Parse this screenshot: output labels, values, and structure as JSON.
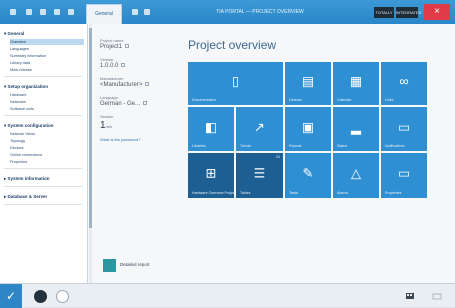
{
  "titlebar": {
    "active_tab": "General",
    "window_title": "TIA PORTAL — PROJECT OVERVIEW",
    "btn_left": "TOTALLY",
    "btn_right": "INTEGRATED",
    "close_glyph": "×"
  },
  "sidebar": {
    "sections": [
      {
        "title": "▾ General",
        "items": [
          "Overview",
          "Languages",
          "Summary information",
          "Library data",
          "Multi-release"
        ]
      },
      {
        "title": "▾ Setup organization",
        "items": [
          "Hardware",
          "Networks",
          "Software units"
        ]
      },
      {
        "title": "▾ System configuration",
        "items": [
          "Network Views",
          "Topology",
          "Devices",
          "Online connections",
          "Properties"
        ]
      },
      {
        "title": "▸ System information",
        "items": []
      },
      {
        "title": "▸ Database & Server",
        "items": []
      }
    ],
    "active_item": "Overview"
  },
  "properties": {
    "fields": [
      {
        "label": "Project name",
        "value": "Project1"
      },
      {
        "label": "Version",
        "value": "1.0.0.0"
      },
      {
        "label": "Manufacturer",
        "value": "<Manufacturer>"
      },
      {
        "label": "Language",
        "value": "German - Ge..."
      },
      {
        "label": "Version",
        "value": "1",
        "unit": "min"
      }
    ],
    "link": "What is the password?",
    "nav_tile_label": "Detailed report"
  },
  "overview": {
    "title": "Project overview",
    "tiles": [
      {
        "label": "Documentation",
        "icon": "document-icon",
        "glyph": "▯",
        "count": "",
        "dark": false
      },
      {
        "label": "Devices",
        "icon": "devices-icon",
        "glyph": "▤",
        "count": "",
        "dark": false
      },
      {
        "label": "Calendar",
        "icon": "calendar-icon",
        "glyph": "▦",
        "count": "",
        "dark": false
      },
      {
        "label": "Links",
        "icon": "link-icon",
        "glyph": "∞",
        "count": "",
        "dark": false
      },
      {
        "label": "Libraries",
        "icon": "libraries-icon",
        "glyph": "◧",
        "count": "",
        "dark": false
      },
      {
        "label": "Trends",
        "icon": "trend-arrow-icon",
        "glyph": "↗",
        "count": "",
        "dark": false
      },
      {
        "label": "Reports",
        "icon": "report-icon",
        "glyph": "▣",
        "count": "",
        "dark": false
      },
      {
        "label": "Status",
        "icon": "chart-icon",
        "glyph": "▂",
        "count": "",
        "dark": false
      },
      {
        "label": "Notifications",
        "icon": "folder-icon",
        "glyph": "▭",
        "count": "",
        "dark": false
      },
      {
        "label": "Hardware Overview Projects",
        "icon": "grid-icon",
        "glyph": "⊞",
        "count": "",
        "dark": true
      },
      {
        "label": "Tables",
        "icon": "list-icon",
        "glyph": "☰",
        "count": "24",
        "dark": true
      },
      {
        "label": "Tasks",
        "icon": "task-icon",
        "glyph": "✎",
        "count": "",
        "dark": false
      },
      {
        "label": "Alarms",
        "icon": "warning-triangle-icon",
        "glyph": "△",
        "count": "",
        "dark": false
      },
      {
        "label": "Properties",
        "icon": "properties-icon",
        "glyph": "▭",
        "count": "",
        "dark": false
      }
    ]
  },
  "taskbar": {
    "start_glyph": "✓"
  }
}
